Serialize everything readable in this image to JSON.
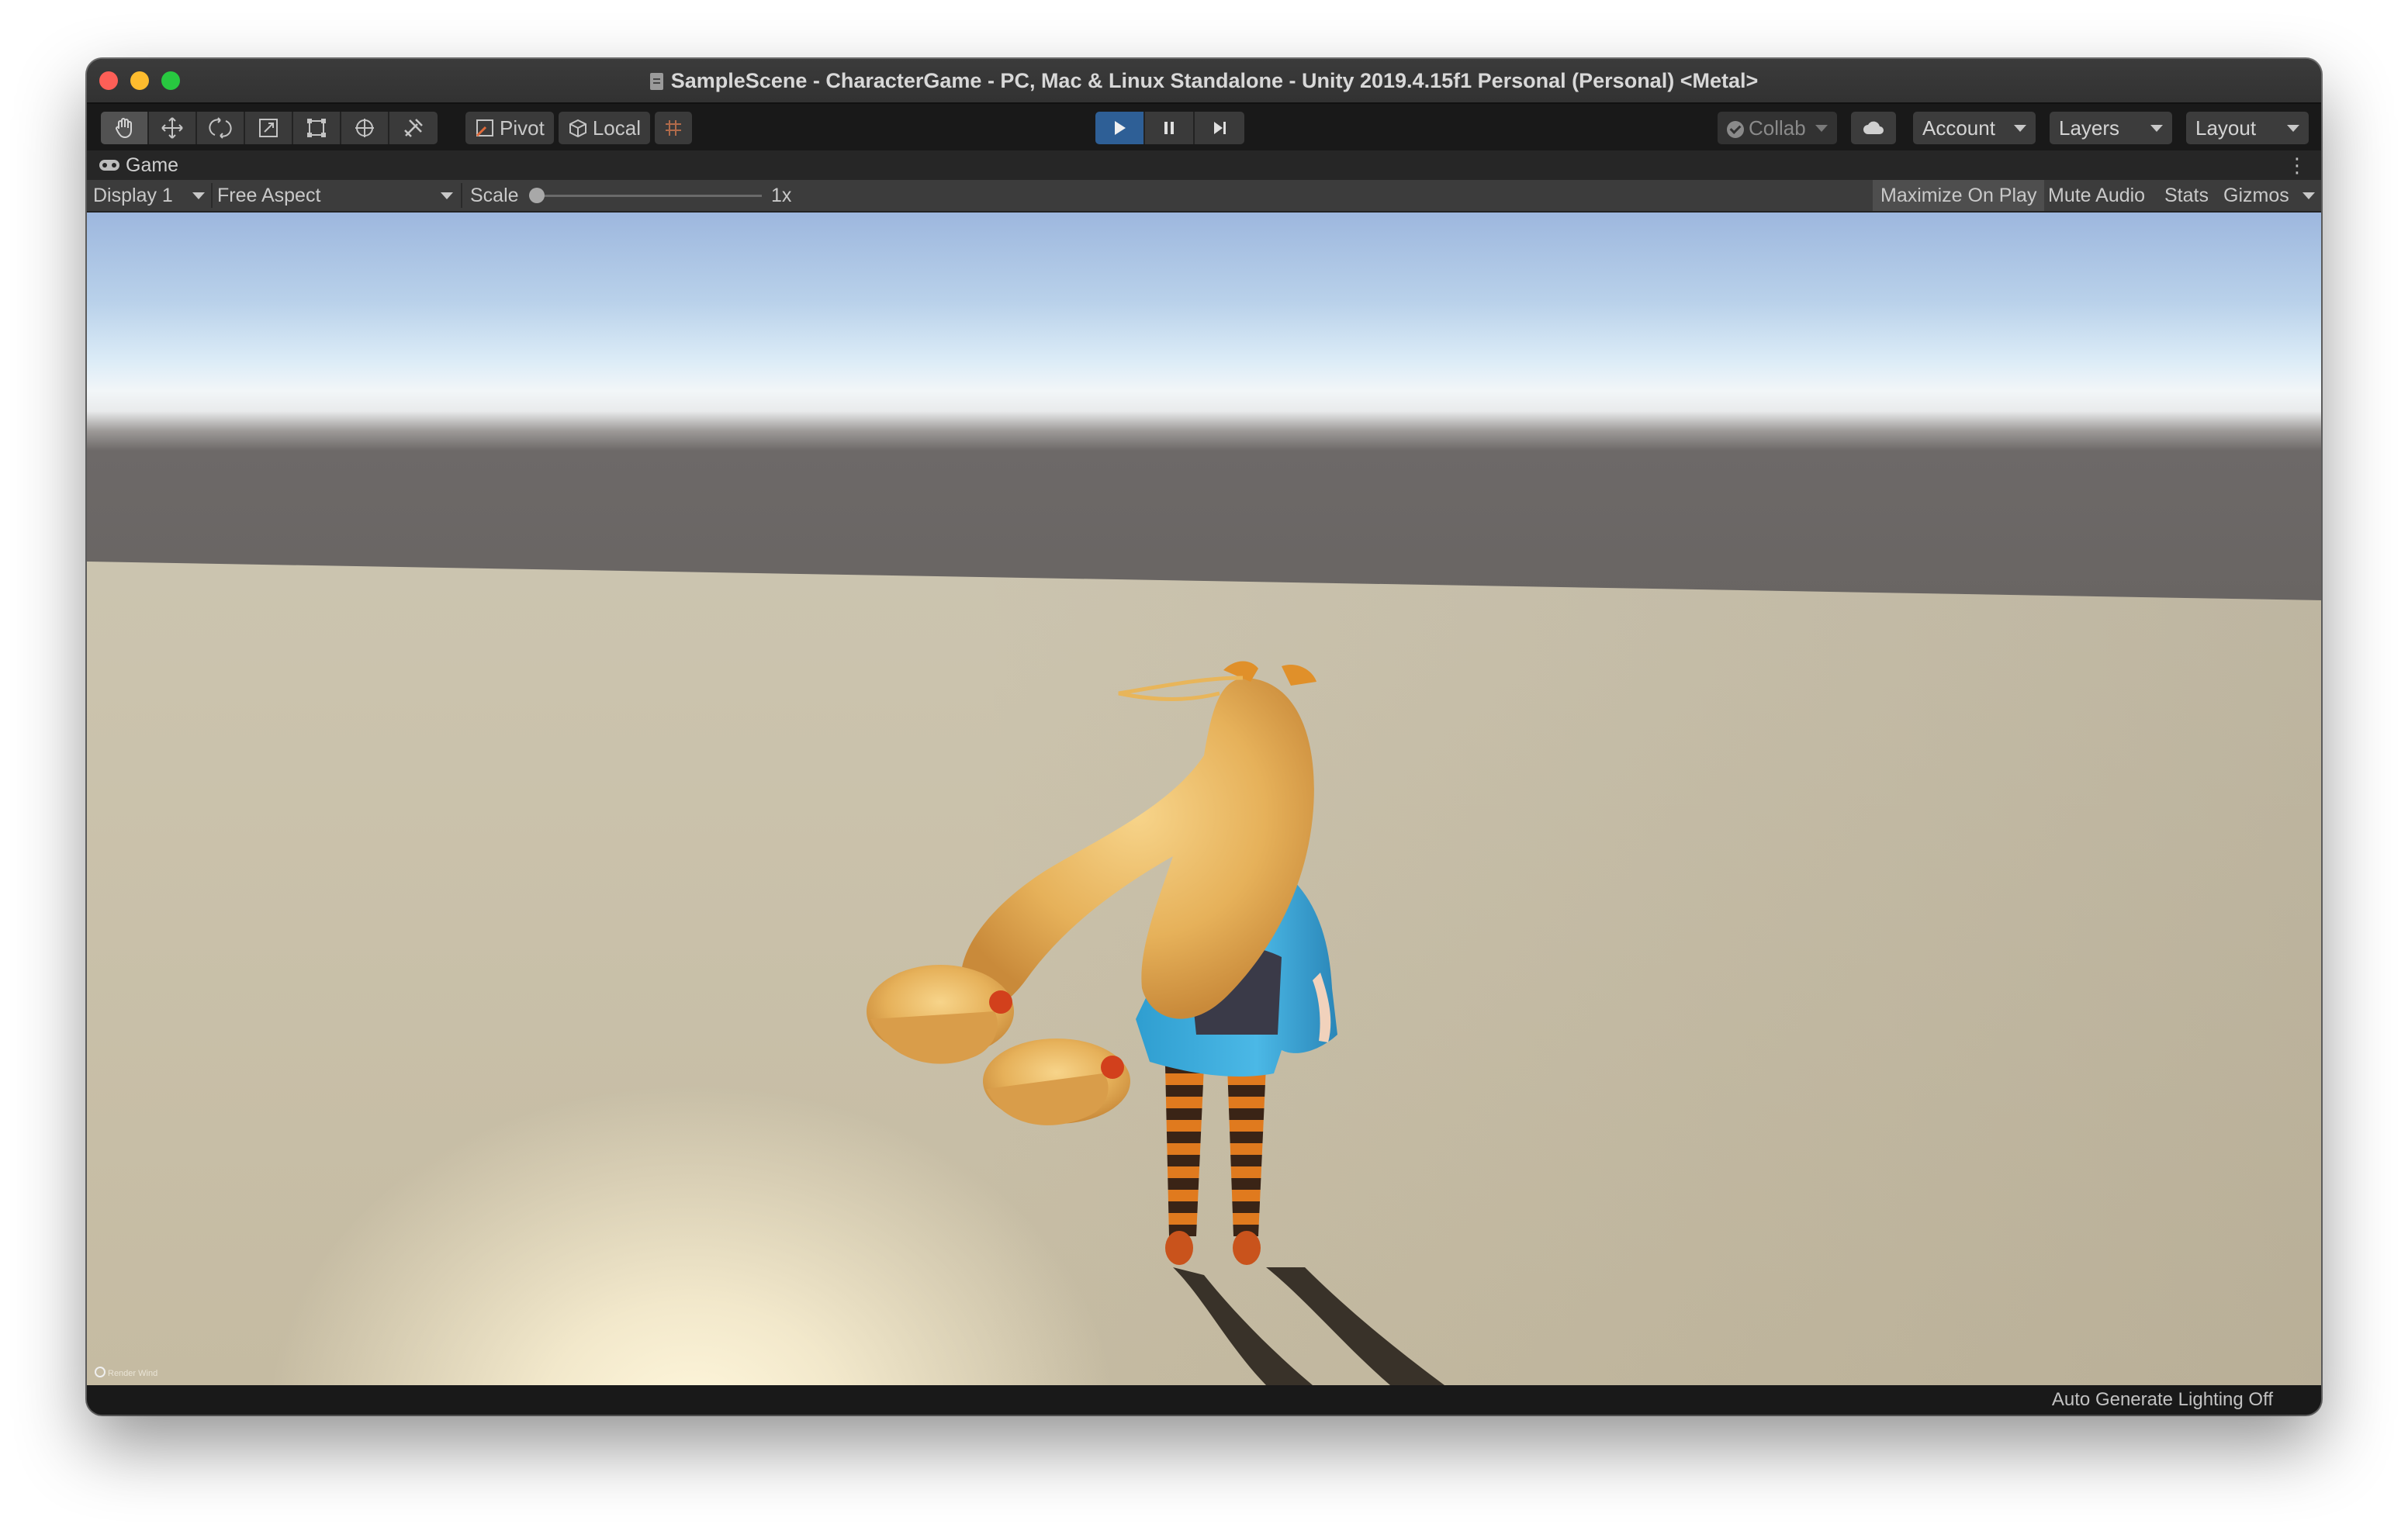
{
  "window": {
    "title": "SampleScene - CharacterGame - PC, Mac & Linux Standalone - Unity 2019.4.15f1 Personal (Personal) <Metal>"
  },
  "toolbar": {
    "tools": [
      {
        "name": "hand-tool",
        "icon": "hand-icon",
        "active": true
      },
      {
        "name": "move-tool",
        "icon": "move-arrows-icon",
        "active": false
      },
      {
        "name": "rotate-tool",
        "icon": "rotate-icon",
        "active": false
      },
      {
        "name": "scale-tool",
        "icon": "scale-icon",
        "active": false
      },
      {
        "name": "rect-tool",
        "icon": "rect-icon",
        "active": false
      },
      {
        "name": "transform-tool",
        "icon": "transform-icon",
        "active": false
      },
      {
        "name": "custom-tool",
        "icon": "tools-icon",
        "active": false
      }
    ],
    "pivot_label": "Pivot",
    "local_label": "Local",
    "collab_label": "Collab",
    "account_label": "Account",
    "layers_label": "Layers",
    "layout_label": "Layout"
  },
  "play_controls": {
    "playing": true
  },
  "game_tab": {
    "label": "Game"
  },
  "game_bar": {
    "display": "Display 1",
    "aspect": "Free Aspect",
    "scale_label": "Scale",
    "scale_value": "1x",
    "maximize_on_play": "Maximize On Play",
    "mute_audio": "Mute Audio",
    "stats": "Stats",
    "gizmos": "Gizmos"
  },
  "viewport": {
    "overlay_text": "Render Wind"
  },
  "status_bar": {
    "text": "Auto Generate Lighting Off"
  },
  "colors": {
    "play_active": "#2e5f96",
    "sky_top": "#9db7de",
    "ground": "#c8c0aa"
  }
}
